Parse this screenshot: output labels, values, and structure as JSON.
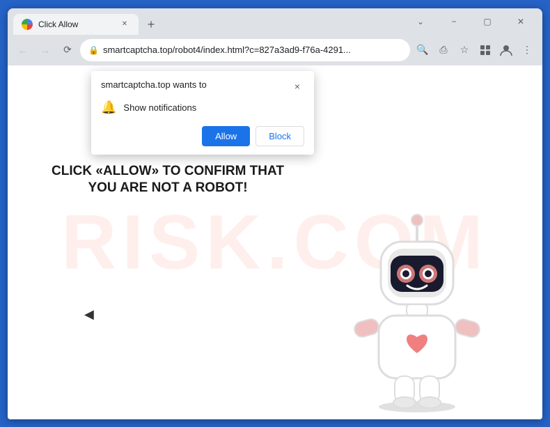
{
  "browser": {
    "tab": {
      "title": "Click Allow",
      "favicon_alt": "globe-icon"
    },
    "new_tab_label": "+",
    "window_controls": {
      "minimize": "−",
      "maximize": "▢",
      "close": "✕",
      "chevron": "⌄"
    },
    "address_bar": {
      "url": "smartcaptcha.top/robot4/index.html?c=827a3ad9-f76a-4291...",
      "lock_icon": "🔒",
      "back_disabled": true,
      "forward_disabled": true
    },
    "toolbar": {
      "search_icon": "🔍",
      "share_icon": "⎙",
      "bookmark_icon": "☆",
      "extensions_icon": "⬛",
      "profile_icon": "👤",
      "menu_icon": "⋮"
    }
  },
  "notification_popup": {
    "site": "smartcaptcha.top wants to",
    "close_label": "×",
    "notification_icon": "🔔",
    "notification_text": "Show notifications",
    "allow_label": "Allow",
    "block_label": "Block"
  },
  "page": {
    "watermark_text": "RISK.COM",
    "main_text": "CLICK «ALLOW» TO CONFIRM THAT YOU ARE NOT A ROBOT!"
  },
  "colors": {
    "browser_border": "#2563c7",
    "allow_btn": "#1a73e8",
    "block_btn": "#ffffff",
    "page_text": "#1a1a1a",
    "watermark": "rgba(255,150,130,0.15)"
  }
}
